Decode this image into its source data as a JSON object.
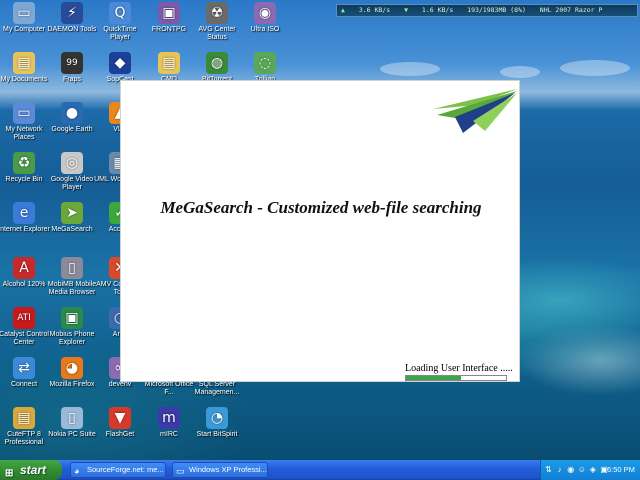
{
  "desktop_icons": [
    {
      "label": "My Computer",
      "icon": "computer-icon",
      "glyph": "▭",
      "color": "#7fa7d6"
    },
    {
      "label": "DAEMON Tools",
      "icon": "daemon-tools-icon",
      "glyph": "⚡",
      "color": "#2a4a9a"
    },
    {
      "label": "QuickTime Player",
      "icon": "quicktime-icon",
      "glyph": "Q",
      "color": "#4a8ad8"
    },
    {
      "label": "FRONTPG",
      "icon": "frontpage-icon",
      "glyph": "▣",
      "color": "#7d5aa8"
    },
    {
      "label": "AVG Center Status",
      "icon": "avg-icon",
      "glyph": "☢",
      "color": "#6a6a6a"
    },
    {
      "label": "Ultra ISO",
      "icon": "ultraiso-icon",
      "glyph": "◉",
      "color": "#8a6ab0"
    },
    {
      "label": "My Documents",
      "icon": "folder-icon",
      "glyph": "▤",
      "color": "#e8c35a"
    },
    {
      "label": "Fraps",
      "icon": "fraps-icon",
      "glyph": "99",
      "color": "#333333"
    },
    {
      "label": "SopCast",
      "icon": "sopcast-icon",
      "glyph": "◆",
      "color": "#1c3f9a"
    },
    {
      "label": "CMD",
      "icon": "folder-icon",
      "glyph": "▤",
      "color": "#e8c35a"
    },
    {
      "label": "BitTorrent",
      "icon": "globe-icon",
      "glyph": "◍",
      "color": "#3a8a3a"
    },
    {
      "label": "Trillian",
      "icon": "trillian-icon",
      "glyph": "◌",
      "color": "#5aa85a"
    },
    {
      "label": "My Network Places",
      "icon": "network-icon",
      "glyph": "▭",
      "color": "#5a8ad8"
    },
    {
      "label": "Google Earth",
      "icon": "google-earth-icon",
      "glyph": "●",
      "color": "#2a6ab0"
    },
    {
      "label": "VLC",
      "icon": "vlc-icon",
      "glyph": "▲",
      "color": "#e8881a"
    },
    {
      "label": "Recycle Bin",
      "icon": "recycle-bin-icon",
      "glyph": "♻",
      "color": "#4a9a4a"
    },
    {
      "label": "Google Video Player",
      "icon": "video-player-icon",
      "glyph": "◎",
      "color": "#c8c8c8"
    },
    {
      "label": "UML Workbench",
      "icon": "uml-icon",
      "glyph": "▦",
      "color": "#6a8aa8"
    },
    {
      "label": "Internet Explorer",
      "icon": "internet-explorer-icon",
      "glyph": "e",
      "color": "#3a7ad8"
    },
    {
      "label": "MeGaSearch",
      "icon": "megasearch-icon",
      "glyph": "➤",
      "color": "#6aa83a"
    },
    {
      "label": "Access",
      "icon": "access-icon",
      "glyph": "✓",
      "color": "#3aa83a"
    },
    {
      "label": "Alcohol 120%",
      "icon": "alcohol-icon",
      "glyph": "A",
      "color": "#c82a2a"
    },
    {
      "label": "MobiMB Mobile Media Browser",
      "icon": "mobile-icon",
      "glyph": "▯",
      "color": "#8a8a9a"
    },
    {
      "label": "AMV Converter Tool",
      "icon": "amv-icon",
      "glyph": "✕",
      "color": "#d84a2a"
    },
    {
      "label": "Catalyst Control Center",
      "icon": "ati-icon",
      "glyph": "ATI",
      "color": "#c81a1a"
    },
    {
      "label": "Mobius Phone Explorer",
      "icon": "phone-icon",
      "glyph": "▣",
      "color": "#2a8a4a"
    },
    {
      "label": "Ares",
      "icon": "ares-icon",
      "glyph": "◔",
      "color": "#3a6ab0"
    },
    {
      "label": "Connect",
      "icon": "connect-icon",
      "glyph": "⇄",
      "color": "#3a8ad8"
    },
    {
      "label": "Mozilla Firefox",
      "icon": "firefox-icon",
      "glyph": "◕",
      "color": "#e8781a"
    },
    {
      "label": "devenv",
      "icon": "devenv-icon",
      "glyph": "∞",
      "color": "#8a6ab0"
    },
    {
      "label": "Microsoft Office F...",
      "icon": "office-icon",
      "glyph": "▤",
      "color": "#e8c35a"
    },
    {
      "label": "SQL Server Managemen...",
      "icon": "sql-server-icon",
      "glyph": "▤",
      "color": "#e8c35a"
    },
    {
      "label": "CuteFTP 8 Professional",
      "icon": "cuteftp-icon",
      "glyph": "▤",
      "color": "#d8a83a"
    },
    {
      "label": "Nokia PC Suite",
      "icon": "nokia-icon",
      "glyph": "▯",
      "color": "#9ab8d8"
    },
    {
      "label": "FlashGet",
      "icon": "flashget-icon",
      "glyph": "▼",
      "color": "#d83a2a"
    },
    {
      "label": "mIRC",
      "icon": "mirc-icon",
      "glyph": "m",
      "color": "#3a3aa8"
    },
    {
      "label": "Start BitSpirit",
      "icon": "bitspirit-icon",
      "glyph": "◔",
      "color": "#3a9ad8"
    }
  ],
  "meter": {
    "upload": "3.6 KB/s",
    "download": "1.6 KB/s",
    "memory": "193/1983MB (8%)",
    "note": "NHL 2007 Razor P"
  },
  "splash": {
    "title": "MeGaSearch - Customized web-file searching",
    "loading_text": "Loading User Interface .....",
    "progress": 0.55
  },
  "taskbar": {
    "start_label": "start",
    "tasks": [
      {
        "label": "SourceForge.net: me...",
        "icon": "firefox-icon",
        "glyph": "◕"
      },
      {
        "label": "Windows XP Professi...",
        "icon": "window-icon",
        "glyph": "▭"
      }
    ],
    "tray_icons": [
      {
        "name": "network-tray-icon",
        "glyph": "⇅"
      },
      {
        "name": "volume-tray-icon",
        "glyph": "♪"
      },
      {
        "name": "antivirus-tray-icon",
        "glyph": "◉"
      },
      {
        "name": "messenger-tray-icon",
        "glyph": "☺"
      },
      {
        "name": "shield-tray-icon",
        "glyph": "◈"
      },
      {
        "name": "update-tray-icon",
        "glyph": "▣"
      }
    ],
    "clock": "6:50 PM"
  },
  "colors": {
    "taskbar": "#245edb",
    "start_button": "#2f8a2f",
    "progress_fill": "#3aa54a",
    "logo_green": "#7cc24a",
    "logo_blue": "#1f3f8a"
  }
}
